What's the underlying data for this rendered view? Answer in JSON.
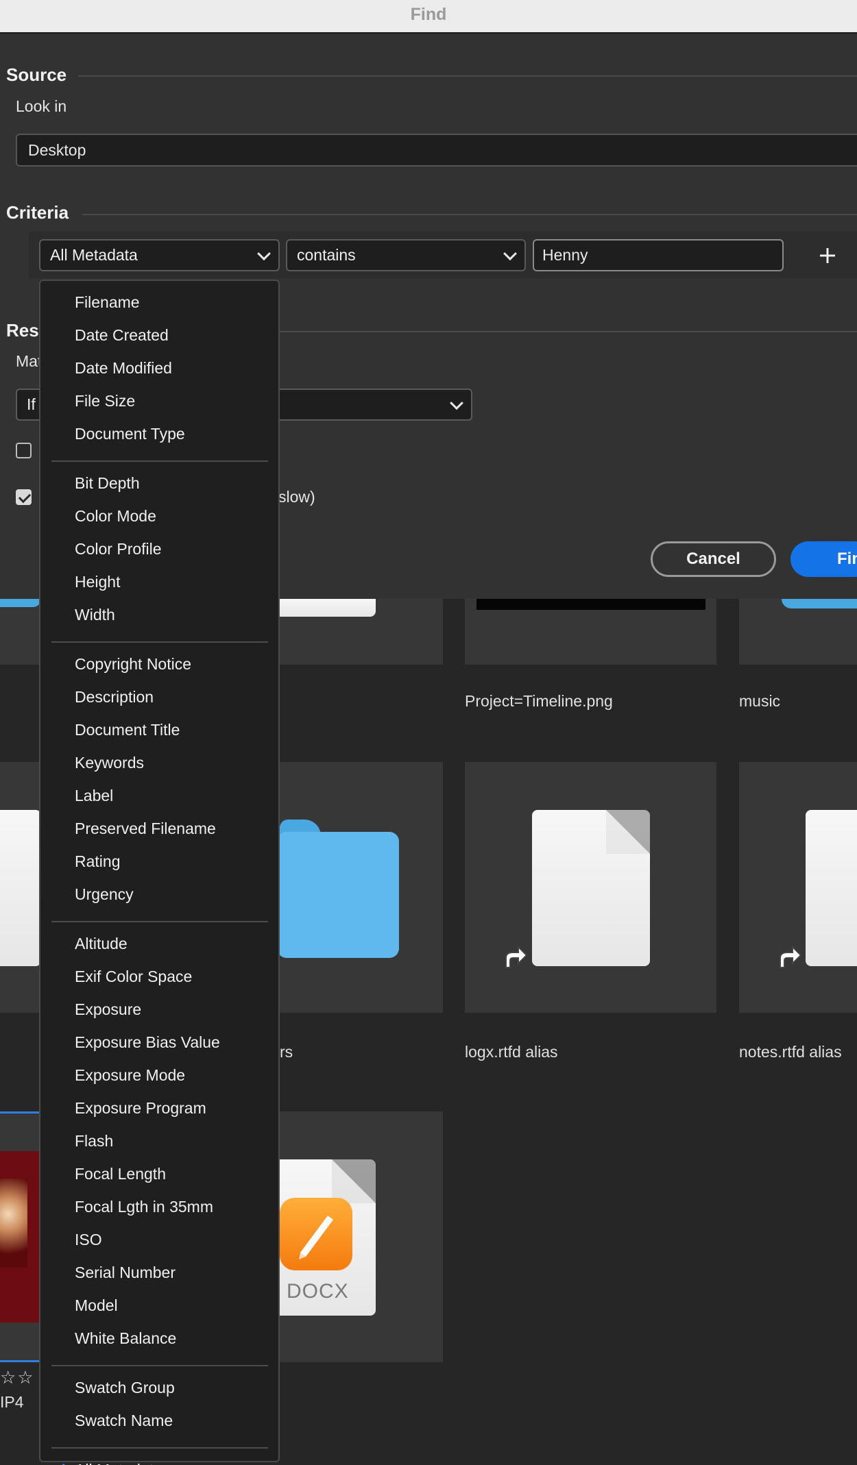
{
  "window": {
    "title": "Find"
  },
  "source": {
    "heading": "Source",
    "look_in_label": "Look in",
    "look_in_value": "Desktop"
  },
  "criteria": {
    "heading": "Criteria",
    "field_value": "All Metadata",
    "operator_value": "contains",
    "search_text": "Henny",
    "add_icon": "plus-icon"
  },
  "results": {
    "heading_visible": "Resu",
    "match_label_visible": "Mat",
    "match_select_visible": "If",
    "option_slow_visible": "slow)"
  },
  "buttons": {
    "cancel": "Cancel",
    "find_visible": "Fin"
  },
  "background": {
    "labels": [
      "Project=Timeline.png",
      "music",
      "rs",
      "logx.rtfd alias",
      "notes.rtfd alias",
      "IP4"
    ],
    "docx_badge": "DOCX",
    "stars": "☆☆"
  },
  "menu": {
    "groups": [
      [
        "Filename",
        "Date Created",
        "Date Modified",
        "File Size",
        "Document Type"
      ],
      [
        "Bit Depth",
        "Color Mode",
        "Color Profile",
        "Height",
        "Width"
      ],
      [
        "Copyright Notice",
        "Description",
        "Document Title",
        "Keywords",
        "Label",
        "Preserved Filename",
        "Rating",
        "Urgency"
      ],
      [
        "Altitude",
        "Exif Color Space",
        "Exposure",
        "Exposure Bias Value",
        "Exposure Mode",
        "Exposure Program",
        "Flash",
        "Focal Length",
        "Focal Lgth in 35mm",
        "ISO",
        "Serial Number",
        "Model",
        "White Balance"
      ],
      [
        "Swatch Group",
        "Swatch Name"
      ],
      [
        "All Metadata"
      ]
    ],
    "selected": "All Metadata"
  },
  "colors": {
    "accent": "#1473e6",
    "check": "#3b8ff6",
    "folder": "#5fb9ee",
    "dialog_bg": "#323232"
  }
}
